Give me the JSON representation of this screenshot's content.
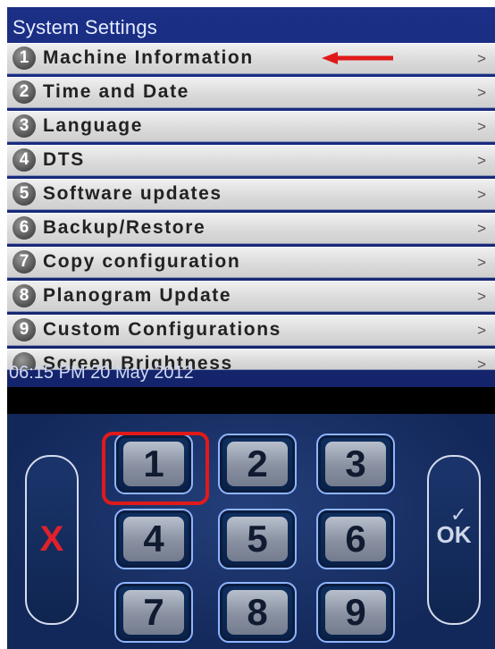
{
  "header": {
    "title": "System Settings"
  },
  "menu": {
    "items": [
      {
        "num": "1",
        "label": "Machine Information",
        "chevron": ">"
      },
      {
        "num": "2",
        "label": "Time and Date",
        "chevron": ">"
      },
      {
        "num": "3",
        "label": "Language",
        "chevron": ">"
      },
      {
        "num": "4",
        "label": "DTS",
        "chevron": ">"
      },
      {
        "num": "5",
        "label": "Software updates",
        "chevron": ">"
      },
      {
        "num": "6",
        "label": "Backup/Restore",
        "chevron": ">"
      },
      {
        "num": "7",
        "label": "Copy configuration",
        "chevron": ">"
      },
      {
        "num": "8",
        "label": "Planogram Update",
        "chevron": ">"
      },
      {
        "num": "9",
        "label": "Custom Configurations",
        "chevron": ">"
      },
      {
        "num": "",
        "label": "Screen Brightness",
        "chevron": ">"
      }
    ]
  },
  "status": {
    "datetime": "06:15 PM 20 May 2012"
  },
  "keypad": {
    "keys": [
      "1",
      "2",
      "3",
      "4",
      "5",
      "6",
      "7",
      "8",
      "9"
    ],
    "cancel_label": "X",
    "ok_label": "OK",
    "ok_check": "✓"
  },
  "colors": {
    "annotation_red": "#e01a1a",
    "screen_blue": "#1b2f86",
    "cancel_red": "#e0212b"
  },
  "annotations": {
    "arrow": "red arrow pointing left to Machine Information",
    "highlight": "red rounded rectangle around key 1"
  }
}
